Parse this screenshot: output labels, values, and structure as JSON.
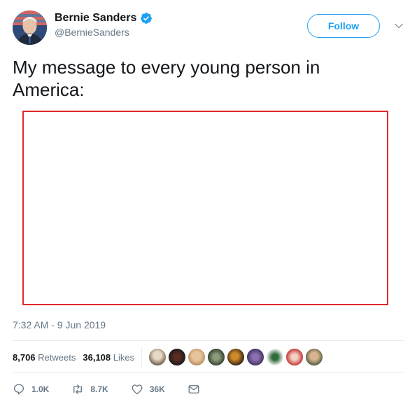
{
  "author": {
    "display_name": "Bernie Sanders",
    "handle": "@BernieSanders",
    "verified": true,
    "avatar_icon": "profile-photo"
  },
  "follow_button_label": "Follow",
  "tweet": {
    "text": "My message to every young person in America:",
    "timestamp": "7:32 AM - 9 Jun 2019"
  },
  "stats": {
    "retweets_count": "8,706",
    "retweets_label": "Retweets",
    "likes_count": "36,108",
    "likes_label": "Likes"
  },
  "actions": {
    "reply_count": "1.0K",
    "retweet_count": "8.7K",
    "like_count": "36K"
  },
  "colors": {
    "accent": "#1da1f2",
    "muted_text": "#657786",
    "media_border": "#e0292b"
  }
}
